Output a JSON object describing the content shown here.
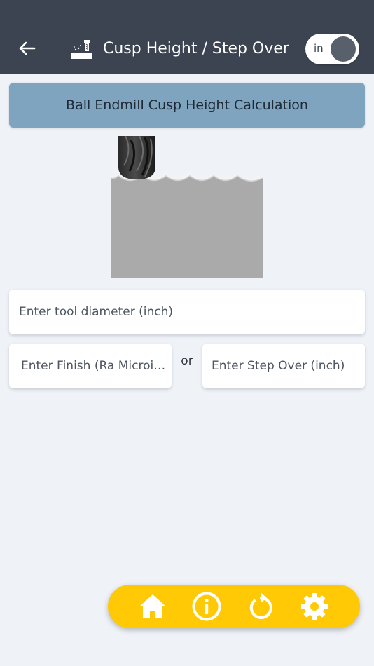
{
  "header": {
    "title": "Cusp Height / Step Over",
    "unit_toggle_label": "in",
    "back_icon": "arrow-left-icon",
    "app_icon": "cnc-mill-icon"
  },
  "banner": {
    "text": "Ball Endmill Cusp Height Calculation"
  },
  "illustration": {
    "description_icon": "ball-endmill-cusp-illustration"
  },
  "inputs": {
    "tool_diameter": {
      "placeholder": "Enter tool diameter (inch)",
      "value": ""
    },
    "finish": {
      "placeholder": "Enter Finish (Ra Microinch)",
      "value": ""
    },
    "step_over": {
      "placeholder": "Enter Step Over (inch)",
      "value": ""
    }
  },
  "or_label": "or",
  "bottom_nav": {
    "items": [
      {
        "icon": "home-icon"
      },
      {
        "icon": "info-icon"
      },
      {
        "icon": "reset-icon"
      },
      {
        "icon": "settings-icon"
      }
    ]
  },
  "colors": {
    "appbar": "#3b4450",
    "banner": "#7ea4bf",
    "background": "#eff3f8",
    "bottom_nav": "#ffc905"
  }
}
